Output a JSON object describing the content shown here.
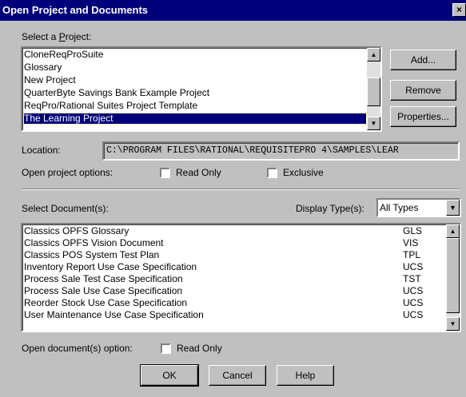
{
  "window": {
    "title": "Open Project and Documents",
    "close_glyph": "×"
  },
  "project": {
    "label": "Select a Project:",
    "label_mnemonic": "P",
    "items": [
      "CloneReqProSuite",
      "Glossary",
      "New Project",
      "QuarterByte Savings Bank Example Project",
      "ReqPro/Rational Suites  Project Template",
      "The Learning Project"
    ],
    "selected": "The Learning Project"
  },
  "buttons": {
    "add": "Add...",
    "remove": "Remove",
    "properties": "Properties...",
    "ok": "OK",
    "cancel": "Cancel",
    "help": "Help"
  },
  "location": {
    "label": "Location:",
    "value": "C:\\PROGRAM FILES\\RATIONAL\\REQUISITEPRO 4\\SAMPLES\\LEAR"
  },
  "project_options": {
    "label": "Open project options:",
    "read_only": {
      "label": "Read Only",
      "checked": false
    },
    "exclusive": {
      "label": "Exclusive",
      "checked": false
    }
  },
  "documents": {
    "label": "Select Document(s):",
    "display_type_label": "Display Type(s):",
    "display_type_value": "All Types",
    "rows": [
      {
        "name": "Classics OPFS Glossary",
        "type": "GLS"
      },
      {
        "name": "Classics OPFS Vision Document",
        "type": "VIS"
      },
      {
        "name": "Classics POS System Test Plan",
        "type": "TPL"
      },
      {
        "name": "Inventory Report Use Case Specification",
        "type": "UCS"
      },
      {
        "name": "Process Sale Test Case Specification",
        "type": "TST"
      },
      {
        "name": "Process Sale Use Case Specification",
        "type": "UCS"
      },
      {
        "name": "Reorder Stock Use Case Specification",
        "type": "UCS"
      },
      {
        "name": "User Maintenance Use Case Specification",
        "type": "UCS"
      }
    ]
  },
  "document_option": {
    "label": "Open document(s) option:",
    "read_only": {
      "label": "Read Only",
      "checked": false
    }
  }
}
